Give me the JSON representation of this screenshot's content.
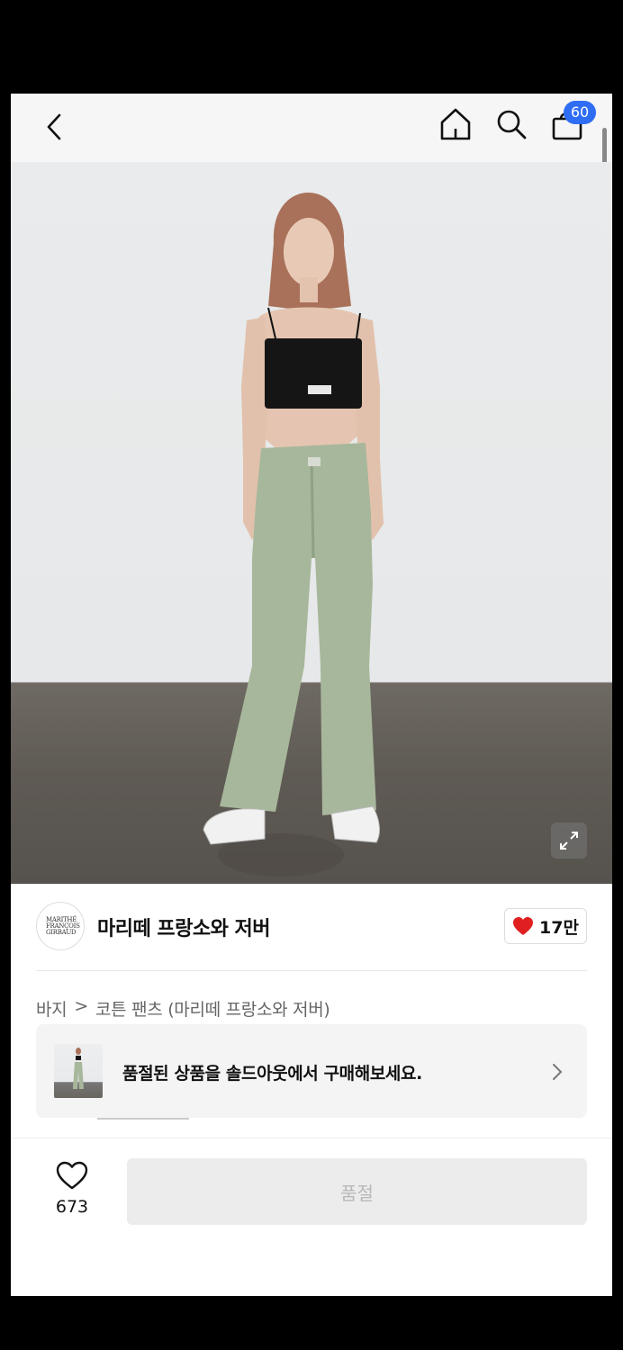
{
  "header": {
    "back_icon": "chevron-left-icon",
    "home_icon": "home-icon",
    "search_icon": "search-icon",
    "cart_icon": "shopping-bag-icon",
    "cart_badge": "60",
    "badge_color": "#2f6df5"
  },
  "product_image": {
    "expand_icon": "expand-icon"
  },
  "brand": {
    "logo_text": "MARITHÉ FRANÇOIS GIRBAUD",
    "name": "마리떼 프랑소와 저버",
    "like_count": "17만",
    "like_icon": "heart-filled-icon",
    "like_color": "#e02020"
  },
  "breadcrumb": {
    "category": "바지",
    "separator": ">",
    "subcategory": "코튼 팬츠 (마리떼 프랑소와 저버)"
  },
  "soldout_banner": {
    "text": "품절된 상품을 솔드아웃에서 구매해보세요.",
    "arrow_icon": "chevron-right-icon"
  },
  "bottom_bar": {
    "wish_icon": "heart-outline-icon",
    "wish_count": "673",
    "buy_label": "품절"
  }
}
